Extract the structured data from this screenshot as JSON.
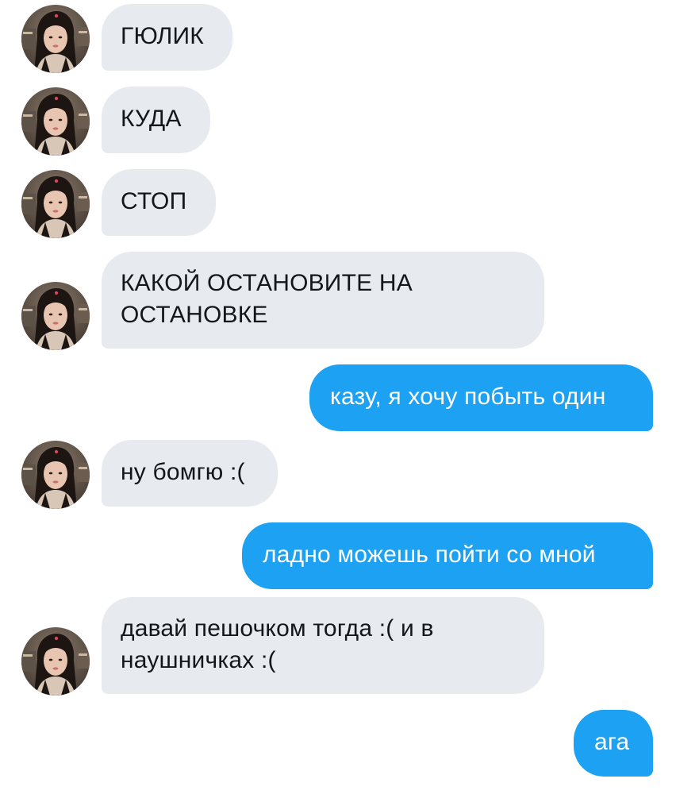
{
  "conversation": {
    "messages": [
      {
        "sender": "contact",
        "text": "ГЮЛИК"
      },
      {
        "sender": "contact",
        "text": "КУДА"
      },
      {
        "sender": "contact",
        "text": "СТОП"
      },
      {
        "sender": "contact",
        "text": "КАКОЙ ОСТАНОВИТЕ НА ОСТАНОВКЕ"
      },
      {
        "sender": "me",
        "text": "казу, я хочу побыть один"
      },
      {
        "sender": "contact",
        "text": "ну бомгю :("
      },
      {
        "sender": "me",
        "text": "ладно можешь пойти со мной"
      },
      {
        "sender": "contact",
        "text": "давай пешочком тогда :( и в наушничках :("
      },
      {
        "sender": "me",
        "text": "ага"
      }
    ]
  },
  "colors": {
    "incoming_bubble": "#e7ebf0",
    "outgoing_bubble": "#1da1f2",
    "incoming_text": "#14171a",
    "outgoing_text": "#ffffff"
  },
  "icons": {
    "avatar": "contact-avatar-photo"
  }
}
